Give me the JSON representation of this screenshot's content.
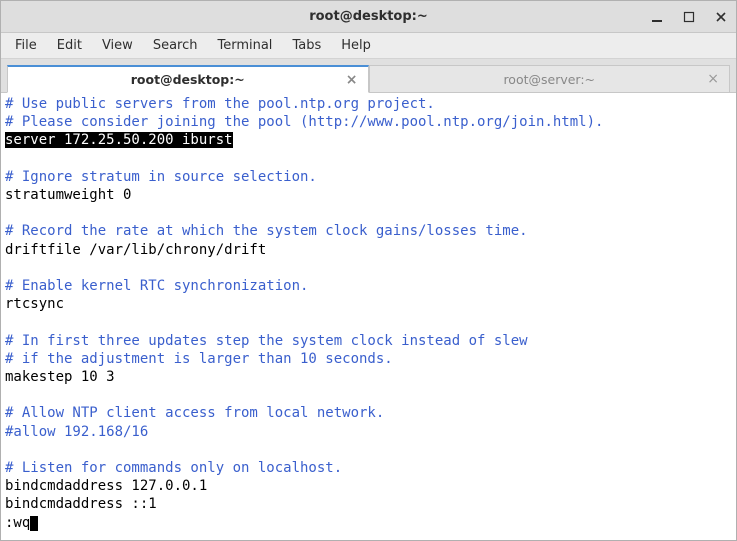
{
  "window": {
    "title": "root@desktop:~",
    "controls": {
      "minimize": "minimize",
      "maximize": "maximize",
      "close": "close"
    }
  },
  "menu": {
    "file": "File",
    "edit": "Edit",
    "view": "View",
    "search": "Search",
    "terminal": "Terminal",
    "tabs": "Tabs",
    "help": "Help"
  },
  "tabs": [
    {
      "label": "root@desktop:~",
      "active": true
    },
    {
      "label": "root@server:~",
      "active": false
    }
  ],
  "content": {
    "l0": "# Use public servers from the pool.ntp.org project.",
    "l1": "# Please consider joining the pool (http://www.pool.ntp.org/join.html).",
    "l2": "server 172.25.50.200 iburst",
    "l3": "",
    "l4": "# Ignore stratum in source selection.",
    "l5": "stratumweight 0",
    "l6": "",
    "l7": "# Record the rate at which the system clock gains/losses time.",
    "l8": "driftfile /var/lib/chrony/drift",
    "l9": "",
    "l10": "# Enable kernel RTC synchronization.",
    "l11": "rtcsync",
    "l12": "",
    "l13": "# In first three updates step the system clock instead of slew",
    "l14": "# if the adjustment is larger than 10 seconds.",
    "l15": "makestep 10 3",
    "l16": "",
    "l17": "# Allow NTP client access from local network.",
    "l18": "#allow 192.168/16",
    "l19": "",
    "l20": "# Listen for commands only on localhost.",
    "l21": "bindcmdaddress 127.0.0.1",
    "l22": "bindcmdaddress ::1",
    "cmd": ":wq"
  }
}
